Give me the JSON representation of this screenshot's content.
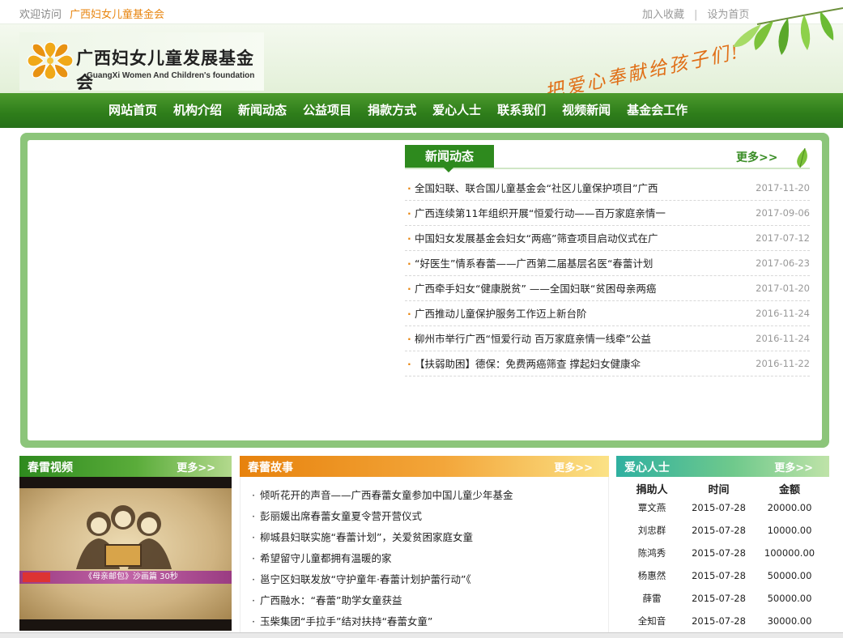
{
  "topbar": {
    "welcome": "欢迎访问",
    "site_name": "广西妇女儿童基金会",
    "bookmark": "加入收藏",
    "separator": "|",
    "set_home": "设为首页"
  },
  "header": {
    "logo_cn": "广西妇女儿童发展基金会",
    "logo_en": "GuangXi Women And Children's foundation",
    "slogan": "把爱心奉献给孩子们!"
  },
  "nav": {
    "items": [
      "网站首页",
      "机构介绍",
      "新闻动态",
      "公益项目",
      "捐款方式",
      "爱心人士",
      "联系我们",
      "视频新闻",
      "基金会工作"
    ]
  },
  "news": {
    "tab": "新闻动态",
    "more": "更多>>",
    "bullet": "·",
    "items": [
      {
        "title": "全国妇联、联合国儿童基金会“社区儿童保护项目”广西",
        "date": "2017-11-20"
      },
      {
        "title": "广西连续第11年组织开展“恒爱行动——百万家庭亲情一",
        "date": "2017-09-06"
      },
      {
        "title": "中国妇女发展基金会妇女“两癌”筛查项目启动仪式在广",
        "date": "2017-07-12"
      },
      {
        "title": "“好医生”情系春蕾——广西第二届基层名医“春蕾计划",
        "date": "2017-06-23"
      },
      {
        "title": "广西牵手妇女“健康脱贫” ——全国妇联“贫困母亲两癌",
        "date": "2017-01-20"
      },
      {
        "title": "广西推动儿童保护服务工作迈上新台阶",
        "date": "2016-11-24"
      },
      {
        "title": "柳州市举行广西“恒爱行动 百万家庭亲情一线牵”公益",
        "date": "2016-11-24"
      },
      {
        "title": "【扶弱助困】德保：免费两癌筛查 撑起妇女健康伞",
        "date": "2016-11-22"
      }
    ]
  },
  "video": {
    "title": "春雷视频",
    "more": "更多>>",
    "caption": "《母亲邮包》沙画篇 30秒"
  },
  "stories": {
    "title": "春蕾故事",
    "more": "更多>>",
    "bullet": "·",
    "items": [
      "倾听花开的声音——广西春蕾女童参加中国儿童少年基金",
      "彭丽媛出席春蕾女童夏令营开营仪式",
      "柳城县妇联实施“春蕾计划”，关爱贫困家庭女童",
      "希望留守儿童都拥有温暖的家",
      "邕宁区妇联发放“守护童年·春蕾计划护蕾行动”《",
      "广西融水：“春蕾”助学女童获益",
      "玉柴集团“手拉手”结对扶持“春蕾女童”"
    ]
  },
  "donors": {
    "title": "爱心人士",
    "more": "更多>>",
    "headers": [
      "捐助人",
      "时间",
      "金额"
    ],
    "rows": [
      [
        "覃文燕",
        "2015-07-28",
        "20000.00"
      ],
      [
        "刘忠群",
        "2015-07-28",
        "10000.00"
      ],
      [
        "陈鸿秀",
        "2015-07-28",
        "100000.00"
      ],
      [
        "杨惠然",
        "2015-07-28",
        "50000.00"
      ],
      [
        "薛雷",
        "2015-07-28",
        "50000.00"
      ],
      [
        "全知音",
        "2015-07-28",
        "30000.00"
      ]
    ]
  },
  "colors": {
    "brand_green": "#2e8a1e",
    "accent_orange": "#e8850f",
    "panel_green": "#8cc57a"
  }
}
